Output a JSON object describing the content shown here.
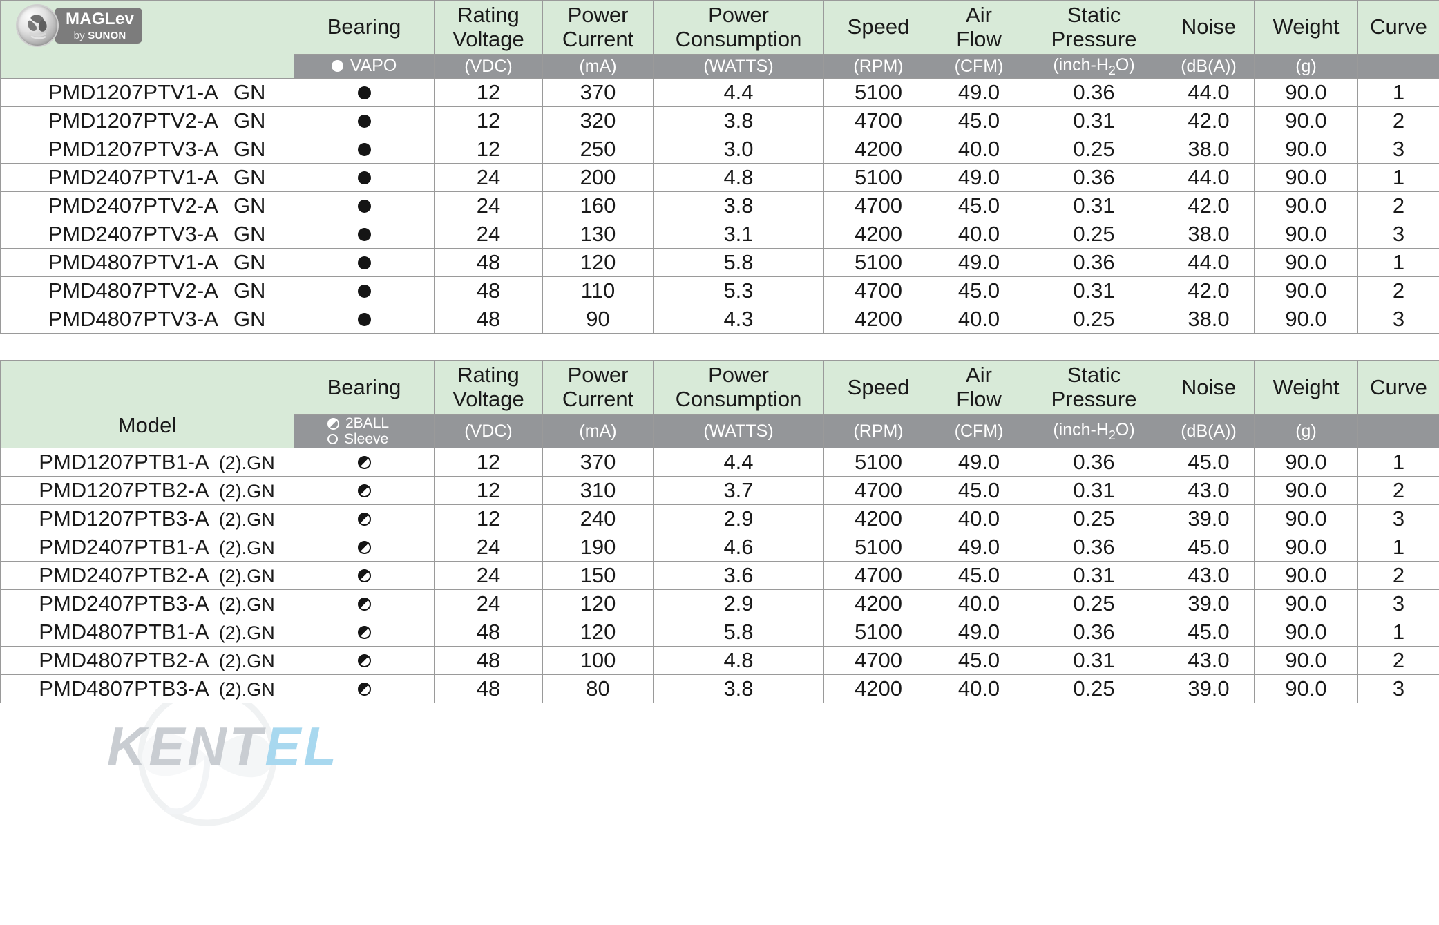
{
  "logo": {
    "brand": "MAGLev",
    "byline_prefix": "by ",
    "byline_brand": "SUNON",
    "icon": "fan-impeller-icon"
  },
  "watermark": {
    "text_primary": "KENT",
    "text_secondary": "EL"
  },
  "columns": {
    "model": "Model",
    "bearing": "Bearing",
    "rating_voltage_l1": "Rating",
    "rating_voltage_l2": "Voltage",
    "power_current_l1": "Power",
    "power_current_l2": "Current",
    "power_consumption_l1": "Power",
    "power_consumption_l2": "Consumption",
    "speed": "Speed",
    "air_flow_l1": "Air",
    "air_flow_l2": "Flow",
    "static_pressure_l1": "Static",
    "static_pressure_l2": "Pressure",
    "noise": "Noise",
    "weight": "Weight",
    "curve": "Curve"
  },
  "units": {
    "voltage": "(VDC)",
    "current": "(mA)",
    "consumption": "(WATTS)",
    "speed": "(RPM)",
    "air_flow": "(CFM)",
    "static_pressure_pre": "(inch-H",
    "static_pressure_sub": "2",
    "static_pressure_post": "O)",
    "noise": "(dB(A))",
    "weight": "(g)"
  },
  "bearing_legend": {
    "vapo": "VAPO",
    "twoball": "2BALL",
    "sleeve": "Sleeve"
  },
  "colors": {
    "header_green": "#d8ead8",
    "units_gray": "#949699",
    "grid_line": "#9a9a9a",
    "text": "#1a1a1a"
  },
  "table_vapo": {
    "rows": [
      {
        "model": "PMD1207PTV1-A",
        "suffix": "GN",
        "bearing": "filled",
        "voltage": "12",
        "current": "370",
        "consumption": "4.4",
        "speed": "5100",
        "air_flow": "49.0",
        "static_pressure": "0.36",
        "noise": "44.0",
        "weight": "90.0",
        "curve": "1"
      },
      {
        "model": "PMD1207PTV2-A",
        "suffix": "GN",
        "bearing": "filled",
        "voltage": "12",
        "current": "320",
        "consumption": "3.8",
        "speed": "4700",
        "air_flow": "45.0",
        "static_pressure": "0.31",
        "noise": "42.0",
        "weight": "90.0",
        "curve": "2"
      },
      {
        "model": "PMD1207PTV3-A",
        "suffix": "GN",
        "bearing": "filled",
        "voltage": "12",
        "current": "250",
        "consumption": "3.0",
        "speed": "4200",
        "air_flow": "40.0",
        "static_pressure": "0.25",
        "noise": "38.0",
        "weight": "90.0",
        "curve": "3"
      },
      {
        "model": "PMD2407PTV1-A",
        "suffix": "GN",
        "bearing": "filled",
        "voltage": "24",
        "current": "200",
        "consumption": "4.8",
        "speed": "5100",
        "air_flow": "49.0",
        "static_pressure": "0.36",
        "noise": "44.0",
        "weight": "90.0",
        "curve": "1"
      },
      {
        "model": "PMD2407PTV2-A",
        "suffix": "GN",
        "bearing": "filled",
        "voltage": "24",
        "current": "160",
        "consumption": "3.8",
        "speed": "4700",
        "air_flow": "45.0",
        "static_pressure": "0.31",
        "noise": "42.0",
        "weight": "90.0",
        "curve": "2"
      },
      {
        "model": "PMD2407PTV3-A",
        "suffix": "GN",
        "bearing": "filled",
        "voltage": "24",
        "current": "130",
        "consumption": "3.1",
        "speed": "4200",
        "air_flow": "40.0",
        "static_pressure": "0.25",
        "noise": "38.0",
        "weight": "90.0",
        "curve": "3"
      },
      {
        "model": "PMD4807PTV1-A",
        "suffix": "GN",
        "bearing": "filled",
        "voltage": "48",
        "current": "120",
        "consumption": "5.8",
        "speed": "5100",
        "air_flow": "49.0",
        "static_pressure": "0.36",
        "noise": "44.0",
        "weight": "90.0",
        "curve": "1"
      },
      {
        "model": "PMD4807PTV2-A",
        "suffix": "GN",
        "bearing": "filled",
        "voltage": "48",
        "current": "110",
        "consumption": "5.3",
        "speed": "4700",
        "air_flow": "45.0",
        "static_pressure": "0.31",
        "noise": "42.0",
        "weight": "90.0",
        "curve": "2"
      },
      {
        "model": "PMD4807PTV3-A",
        "suffix": "GN",
        "bearing": "filled",
        "voltage": "48",
        "current": "90",
        "consumption": "4.3",
        "speed": "4200",
        "air_flow": "40.0",
        "static_pressure": "0.25",
        "noise": "38.0",
        "weight": "90.0",
        "curve": "3"
      }
    ]
  },
  "table_ball": {
    "rows": [
      {
        "model": "PMD1207PTB1-A",
        "suffix": "(2).GN",
        "bearing": "half",
        "voltage": "12",
        "current": "370",
        "consumption": "4.4",
        "speed": "5100",
        "air_flow": "49.0",
        "static_pressure": "0.36",
        "noise": "45.0",
        "weight": "90.0",
        "curve": "1"
      },
      {
        "model": "PMD1207PTB2-A",
        "suffix": "(2).GN",
        "bearing": "half",
        "voltage": "12",
        "current": "310",
        "consumption": "3.7",
        "speed": "4700",
        "air_flow": "45.0",
        "static_pressure": "0.31",
        "noise": "43.0",
        "weight": "90.0",
        "curve": "2"
      },
      {
        "model": "PMD1207PTB3-A",
        "suffix": "(2).GN",
        "bearing": "half",
        "voltage": "12",
        "current": "240",
        "consumption": "2.9",
        "speed": "4200",
        "air_flow": "40.0",
        "static_pressure": "0.25",
        "noise": "39.0",
        "weight": "90.0",
        "curve": "3"
      },
      {
        "model": "PMD2407PTB1-A",
        "suffix": "(2).GN",
        "bearing": "half",
        "voltage": "24",
        "current": "190",
        "consumption": "4.6",
        "speed": "5100",
        "air_flow": "49.0",
        "static_pressure": "0.36",
        "noise": "45.0",
        "weight": "90.0",
        "curve": "1"
      },
      {
        "model": "PMD2407PTB2-A",
        "suffix": "(2).GN",
        "bearing": "half",
        "voltage": "24",
        "current": "150",
        "consumption": "3.6",
        "speed": "4700",
        "air_flow": "45.0",
        "static_pressure": "0.31",
        "noise": "43.0",
        "weight": "90.0",
        "curve": "2"
      },
      {
        "model": "PMD2407PTB3-A",
        "suffix": "(2).GN",
        "bearing": "half",
        "voltage": "24",
        "current": "120",
        "consumption": "2.9",
        "speed": "4200",
        "air_flow": "40.0",
        "static_pressure": "0.25",
        "noise": "39.0",
        "weight": "90.0",
        "curve": "3"
      },
      {
        "model": "PMD4807PTB1-A",
        "suffix": "(2).GN",
        "bearing": "half",
        "voltage": "48",
        "current": "120",
        "consumption": "5.8",
        "speed": "5100",
        "air_flow": "49.0",
        "static_pressure": "0.36",
        "noise": "45.0",
        "weight": "90.0",
        "curve": "1"
      },
      {
        "model": "PMD4807PTB2-A",
        "suffix": "(2).GN",
        "bearing": "half",
        "voltage": "48",
        "current": "100",
        "consumption": "4.8",
        "speed": "4700",
        "air_flow": "45.0",
        "static_pressure": "0.31",
        "noise": "43.0",
        "weight": "90.0",
        "curve": "2"
      },
      {
        "model": "PMD4807PTB3-A",
        "suffix": "(2).GN",
        "bearing": "half",
        "voltage": "48",
        "current": "80",
        "consumption": "3.8",
        "speed": "4200",
        "air_flow": "40.0",
        "static_pressure": "0.25",
        "noise": "39.0",
        "weight": "90.0",
        "curve": "3"
      }
    ]
  }
}
